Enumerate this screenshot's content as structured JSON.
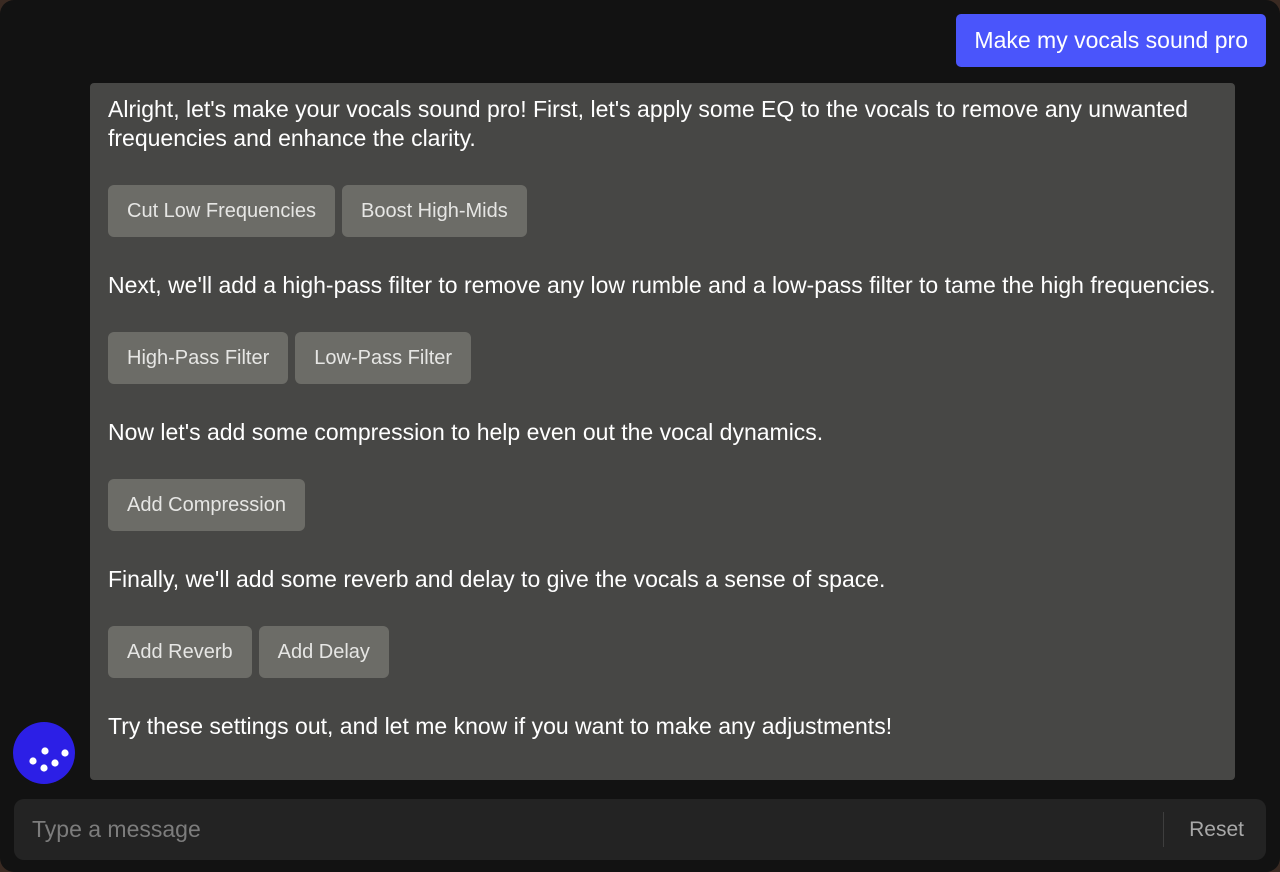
{
  "user_message": "Make my vocals sound pro",
  "assistant": {
    "sections": [
      {
        "text": "Alright, let's make your vocals sound pro! First, let's apply some EQ to the vocals to remove any unwanted frequencies and enhance the clarity.",
        "buttons": [
          "Cut Low Frequencies",
          "Boost High-Mids"
        ]
      },
      {
        "text": "Next, we'll add a high-pass filter to remove any low rumble and a low-pass filter to tame the high frequencies.",
        "buttons": [
          "High-Pass Filter",
          "Low-Pass Filter"
        ]
      },
      {
        "text": "Now let's add some compression to help even out the vocal dynamics.",
        "buttons": [
          "Add Compression"
        ]
      },
      {
        "text": "Finally, we'll add some reverb and delay to give the vocals a sense of space.",
        "buttons": [
          "Add Reverb",
          "Add Delay"
        ]
      }
    ],
    "closing": "Try these settings out, and let me know if you want to make any adjustments!"
  },
  "composer": {
    "placeholder": "Type a message",
    "reset_label": "Reset"
  },
  "avatar": {
    "icon": "dots-logo-icon"
  },
  "colors": {
    "accent": "#4a55fb",
    "avatar_bg": "#2c1fe6",
    "assistant_bubble": "#474745",
    "action_button": "#6c6c67",
    "background": "#121212"
  }
}
